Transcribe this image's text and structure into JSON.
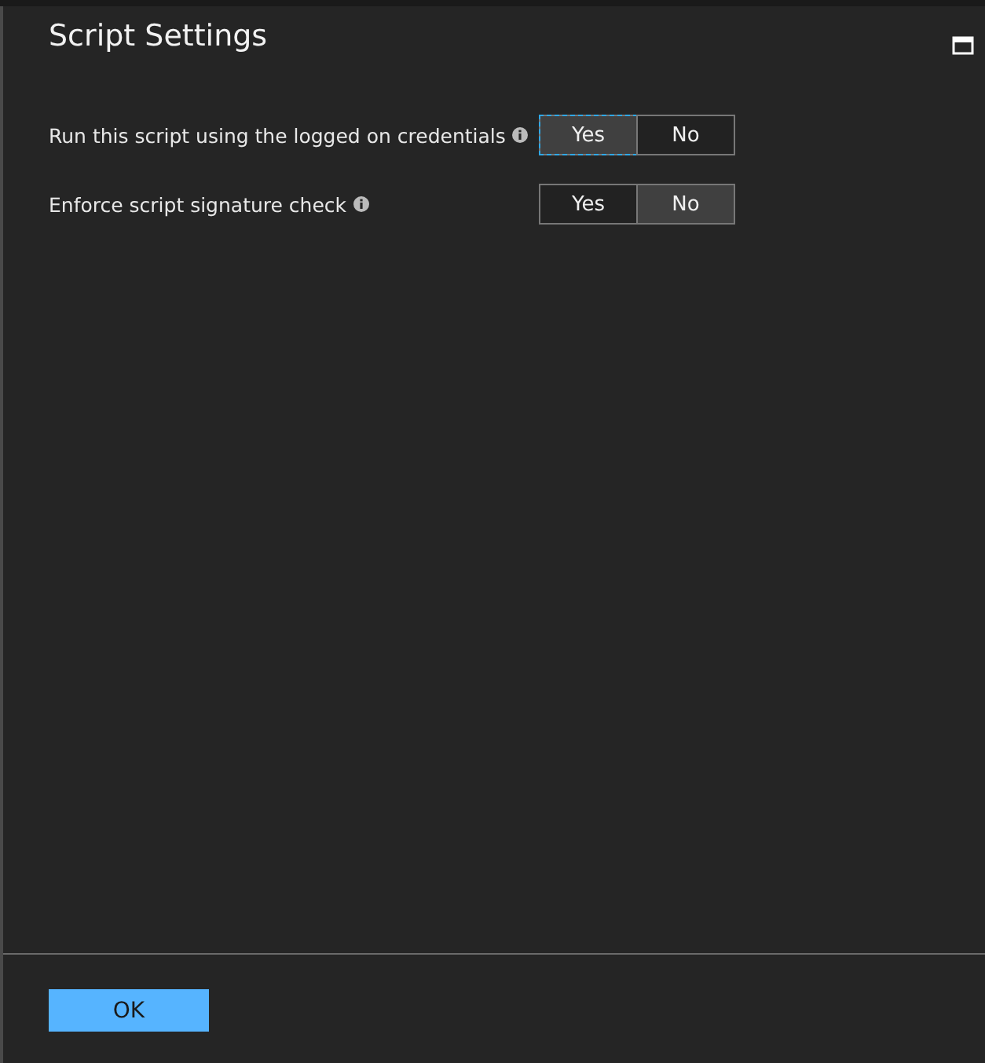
{
  "panel": {
    "title": "Script Settings"
  },
  "settings": [
    {
      "label": "Run this script using the logged on credentials",
      "options": [
        {
          "label": "Yes",
          "selected": true,
          "focused": true
        },
        {
          "label": "No",
          "selected": false,
          "focused": false
        }
      ]
    },
    {
      "label": "Enforce script signature check",
      "options": [
        {
          "label": "Yes",
          "selected": false,
          "focused": false
        },
        {
          "label": "No",
          "selected": true,
          "focused": false
        }
      ]
    }
  ],
  "footer": {
    "ok_button": "OK"
  }
}
